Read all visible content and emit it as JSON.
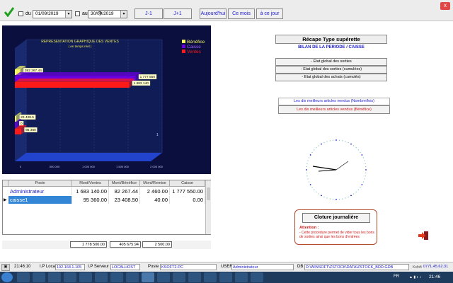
{
  "toolbar": {
    "du_label": "du",
    "du_value": "01/09/2019",
    "au_label": "au",
    "au_value": "30/09/2019",
    "help_label": "?",
    "j_minus": "J-1",
    "j_plus": "J+1",
    "aujourdhui": "Aujourd'hui",
    "ce_mois": "Ce mois",
    "a_ce_jour": "à ce jour",
    "close_label": "x"
  },
  "chart_data": {
    "type": "bar",
    "title": "REPRESENTATION GRAPHIQUE DES VENTES",
    "subtitle": "( en temps réel )",
    "orientation": "horizontal",
    "categories": [
      "Administrateur",
      "caisse1"
    ],
    "series": [
      {
        "name": "Bénéfice",
        "color": "#f5f560",
        "values": [
          82267.44,
          23408.5
        ]
      },
      {
        "name": "Caisse",
        "color": "#6a00e0",
        "values": [
          1777550,
          0
        ]
      },
      {
        "name": "Ventes",
        "color": "#ff1a1a",
        "values": [
          1683140,
          95360
        ]
      }
    ],
    "data_labels": {
      "Bénéfice": [
        "382 267.44",
        "23 408.5"
      ],
      "Caisse": [
        "1 777 550",
        "0"
      ],
      "Ventes": [
        "1 683 140",
        "95 360"
      ]
    },
    "x_ticks": [
      "0",
      "500 000",
      "1 000 000",
      "1 500 000",
      "2 000 000"
    ],
    "xlim": [
      0,
      2000000
    ],
    "grid": true,
    "legend_position": "top-right",
    "marker_label": "1"
  },
  "grid": {
    "headers": [
      "Poste",
      "Mont/Ventes",
      "Mont/Bénéfice",
      "Mont/Remise",
      "Caisse"
    ],
    "rows": [
      [
        "Administrateur",
        "1 683 140.00",
        "82 267.44",
        "2 460.00",
        "1 777 550.00"
      ],
      [
        "caisse1",
        "95 360.00",
        "23 408.50",
        "40.00",
        "0.00"
      ]
    ],
    "totals": [
      "1 778 500.00",
      "405 675.94",
      "2 500.00"
    ]
  },
  "right_panel": {
    "recap_title": "Récape Type supérette",
    "bilan": "BILAN DE LA PERIODE / CAISSE",
    "etat_sorties": "- Etat global des sorties",
    "etat_sorties_cumulees": "- Etat global des sorties (cumulées)",
    "etat_achats_cumules": "- Etat global des achats (cumulés)",
    "top10_nombre": "Les dix meilleurs articles vendus (Nombre/fois)",
    "top10_benefice": "Les dix meilleurs articles vendus (Bénéfice)",
    "cloture_button": "Cloture journalière",
    "attention_title": "Attention :",
    "attention_text": "- Cette procédure permet de vider tous les bons de sorties ainsi que les bons d'entrées"
  },
  "status": {
    "time": "21:46:10",
    "ip_local_label": "I.P Local",
    "ip_local": "192.168.1.105",
    "ip_serveur_label": "I.P Serveur",
    "ip_serveur": "LOCALHOST",
    "poste_label": "Poste",
    "poste": "KSOFT2-PC",
    "user_label": "USER",
    "user": "Administrateur",
    "db_label": "DB",
    "db": "D:\\WINSOFT\\ZSTOCK\\DATA\\ZSTOCK_BDD.GDB",
    "phone_label": "Ksfoft",
    "phone": "0771.45.62.31"
  },
  "taskbar": {
    "lang": "FR",
    "clock": "21:46"
  }
}
